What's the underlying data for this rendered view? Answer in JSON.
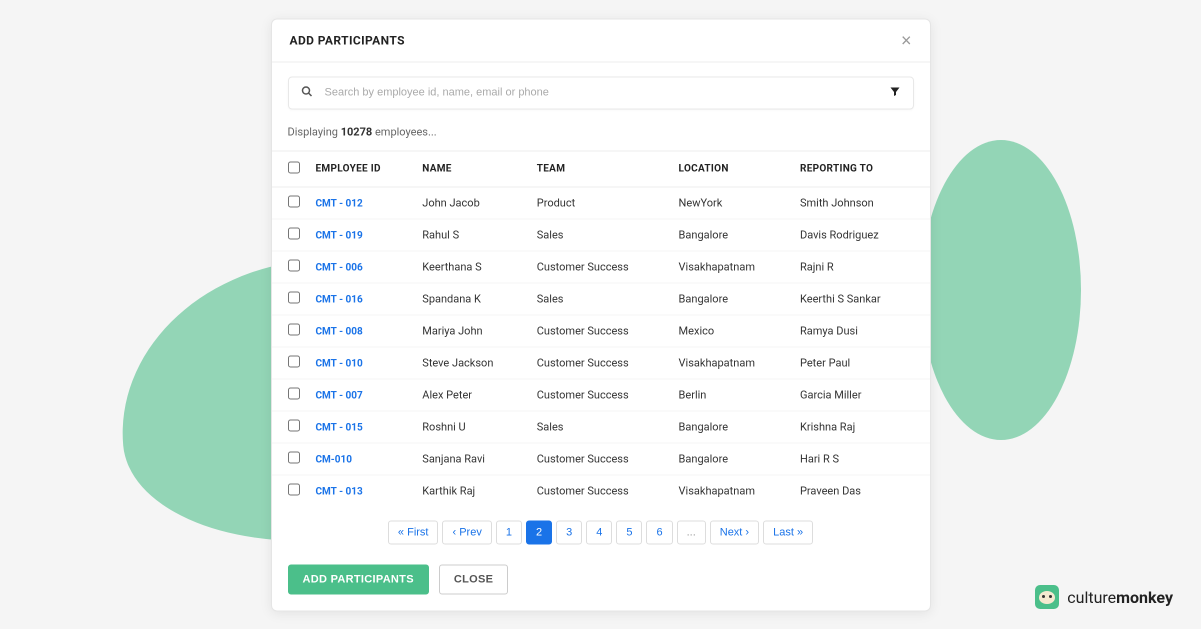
{
  "modal": {
    "title": "ADD PARTICIPANTS",
    "close_label": "×"
  },
  "search": {
    "placeholder": "Search by employee id, name, email or phone"
  },
  "count": {
    "prefix": "Displaying ",
    "value": "10278",
    "suffix": " employees..."
  },
  "headers": {
    "employee_id": "EMPLOYEE ID",
    "name": "NAME",
    "team": "TEAM",
    "location": "LOCATION",
    "reporting_to": "REPORTING TO"
  },
  "rows": [
    {
      "id": "CMT - 012",
      "name": "John Jacob",
      "team": "Product",
      "location": "NewYork",
      "reporting_to": "Smith Johnson"
    },
    {
      "id": "CMT - 019",
      "name": "Rahul S",
      "team": "Sales",
      "location": "Bangalore",
      "reporting_to": "Davis Rodriguez"
    },
    {
      "id": "CMT - 006",
      "name": "Keerthana S",
      "team": "Customer Success",
      "location": "Visakhapatnam",
      "reporting_to": "Rajni R"
    },
    {
      "id": "CMT - 016",
      "name": "Spandana K",
      "team": "Sales",
      "location": "Bangalore",
      "reporting_to": "Keerthi S Sankar"
    },
    {
      "id": "CMT - 008",
      "name": "Mariya John",
      "team": "Customer Success",
      "location": "Mexico",
      "reporting_to": "Ramya Dusi"
    },
    {
      "id": "CMT - 010",
      "name": "Steve Jackson",
      "team": "Customer Success",
      "location": "Visakhapatnam",
      "reporting_to": "Peter Paul"
    },
    {
      "id": "CMT - 007",
      "name": "Alex Peter",
      "team": "Customer Success",
      "location": "Berlin",
      "reporting_to": "Garcia Miller"
    },
    {
      "id": "CMT - 015",
      "name": "Roshni U",
      "team": "Sales",
      "location": "Bangalore",
      "reporting_to": "Krishna Raj"
    },
    {
      "id": "CM-010",
      "name": "Sanjana Ravi",
      "team": "Customer Success",
      "location": "Bangalore",
      "reporting_to": "Hari R S"
    },
    {
      "id": "CMT - 013",
      "name": "Karthik Raj",
      "team": "Customer Success",
      "location": "Visakhapatnam",
      "reporting_to": "Praveen Das"
    }
  ],
  "pagination": {
    "first": "« First",
    "prev": "‹ Prev",
    "pages": [
      "1",
      "2",
      "3",
      "4",
      "5",
      "6"
    ],
    "active_index": 1,
    "ellipsis": "...",
    "next": "Next ›",
    "last": "Last »"
  },
  "footer": {
    "add_label": "ADD PARTICIPANTS",
    "close_label": "CLOSE"
  },
  "brand": {
    "part1": "culture",
    "part2": "monkey"
  }
}
